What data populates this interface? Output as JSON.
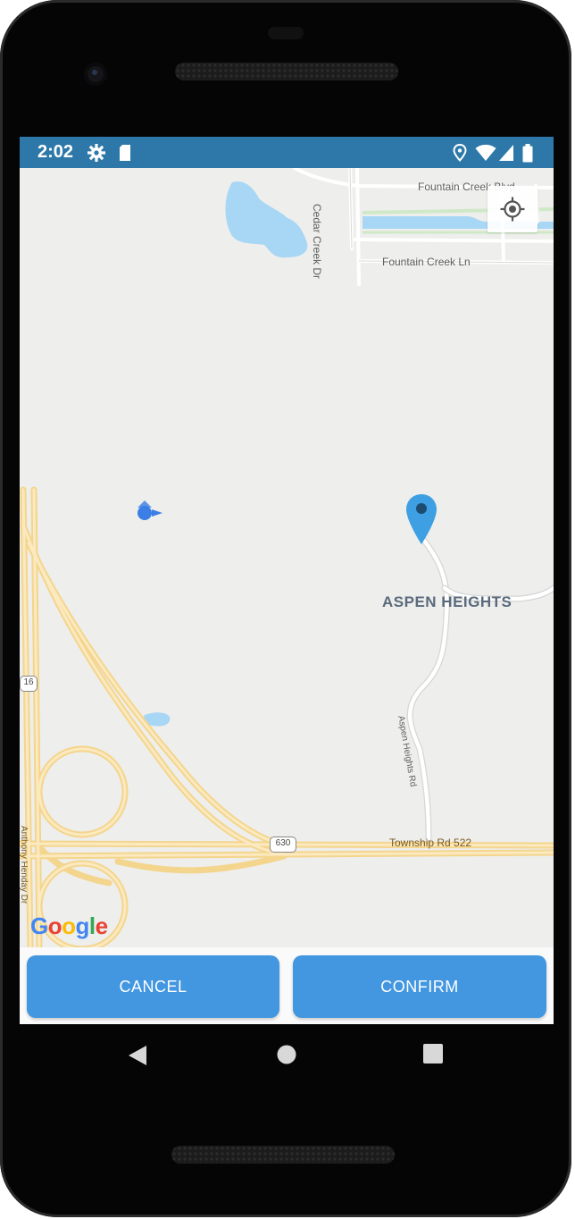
{
  "status_bar": {
    "time": "2:02",
    "icons": [
      "settings-gear-icon",
      "sd-card-icon",
      "location-icon",
      "wifi-icon",
      "signal-icon",
      "battery-icon"
    ],
    "background_color": "#2d78a8"
  },
  "map": {
    "labels": {
      "fountain_creek_blvd": "Fountain Creek Blvd",
      "fountain_creek_ln": "Fountain Creek Ln",
      "cedar_creek_dr": "Cedar Creek Dr",
      "aspen_heights": "ASPEN HEIGHTS",
      "aspen_heights_road": "Aspen Heights Rd",
      "township_rd": "Township Rd 522",
      "highway_shield_16": "16",
      "highway_shield_630": "630",
      "anthony_henday": "Anthony Henday Dr"
    },
    "attribution": "Google",
    "marker_color": "#3ea0e2",
    "my_location_button": "my-location-icon"
  },
  "buttons": {
    "cancel": "CANCEL",
    "confirm": "CONFIRM",
    "color": "#4297e0"
  },
  "nav_bar": {
    "icons": [
      "back-icon",
      "home-icon",
      "recents-icon"
    ]
  }
}
